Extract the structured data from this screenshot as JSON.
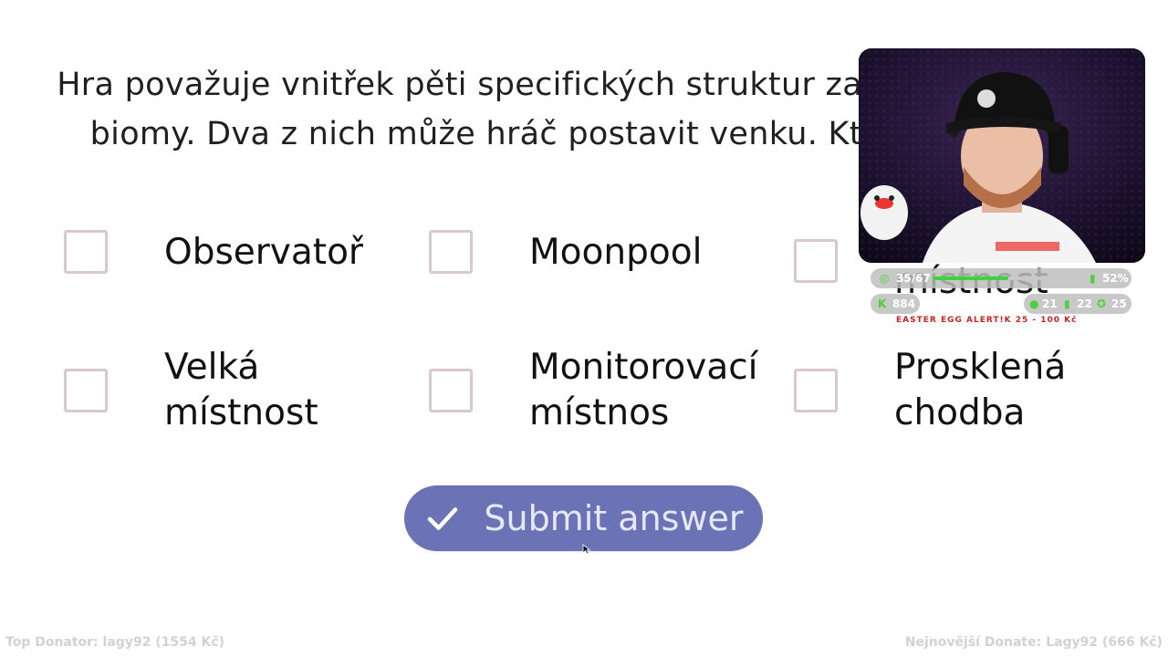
{
  "question": {
    "line1": "Hra považuje vnitřek pěti specifických struktur za své",
    "line2": "biomy. Dva z nich může hráč postavit venku. Kter"
  },
  "options": [
    {
      "label": "Observatoř"
    },
    {
      "label": "Moonpool"
    },
    {
      "label": "místnost"
    },
    {
      "label": "Velká\nmístnost"
    },
    {
      "label": "Monitorovací\nmístnos"
    },
    {
      "label": "Prosklená\nchodba"
    }
  ],
  "submit": {
    "label": "Submit answer",
    "icon": "check-icon"
  },
  "stream_overlay": {
    "goal_text": "35/67",
    "goal_progress": 0.52,
    "percent": "52%",
    "followers": "884",
    "viewers": "21",
    "chat": "22",
    "subs": "25",
    "ticker": "EASTER EGG ALERT!K 25 - 100 Kč"
  },
  "footer": {
    "left": "Top Donator: lagy92  (1554 Kč)",
    "right": "Nejnovější Donate: Lagy92  (666 Kč)"
  },
  "colors": {
    "submit_bg": "#6b73b6",
    "checkbox_border": "#d9c9cd",
    "accent_green": "#3fd23a"
  }
}
